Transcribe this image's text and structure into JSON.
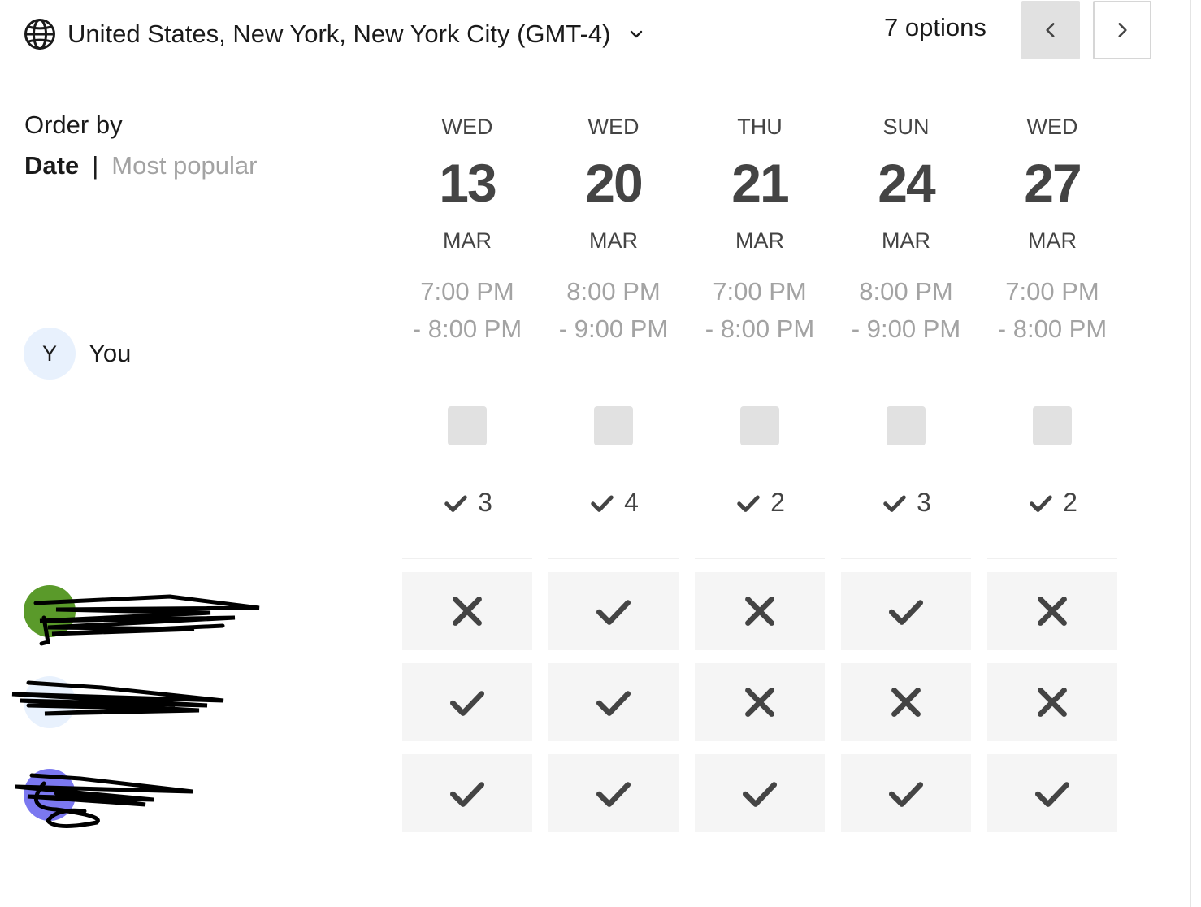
{
  "timezone": {
    "label": "United States, New York, New York City (GMT-4)"
  },
  "pager": {
    "options_label": "7 options"
  },
  "order_by": {
    "title": "Order by",
    "date": "Date",
    "separator": "|",
    "popular": "Most popular"
  },
  "columns": [
    {
      "dow": "WED",
      "day": "13",
      "month": "MAR",
      "time_start": "7:00 PM",
      "time_end": "- 8:00 PM",
      "count": "3"
    },
    {
      "dow": "WED",
      "day": "20",
      "month": "MAR",
      "time_start": "8:00 PM",
      "time_end": "- 9:00 PM",
      "count": "4"
    },
    {
      "dow": "THU",
      "day": "21",
      "month": "MAR",
      "time_start": "7:00 PM",
      "time_end": "- 8:00 PM",
      "count": "2"
    },
    {
      "dow": "SUN",
      "day": "24",
      "month": "MAR",
      "time_start": "8:00 PM",
      "time_end": "- 9:00 PM",
      "count": "3"
    },
    {
      "dow": "WED",
      "day": "27",
      "month": "MAR",
      "time_start": "7:00 PM",
      "time_end": "- 8:00 PM",
      "count": "2"
    }
  ],
  "you": {
    "initial": "Y",
    "name": "You"
  },
  "participants": [
    {
      "avatar_color": "#5a9a2a",
      "votes": [
        "no",
        "yes",
        "no",
        "yes",
        "no"
      ]
    },
    {
      "avatar_color": "#e8f1fd",
      "votes": [
        "yes",
        "yes",
        "no",
        "no",
        "no"
      ]
    },
    {
      "avatar_color": "#7b78f0",
      "votes": [
        "yes",
        "yes",
        "yes",
        "yes",
        "yes"
      ]
    }
  ],
  "colors": {
    "icon": "#444444",
    "muted": "#a3a3a3",
    "cell_bg": "#f5f5f5",
    "checkbox": "#e1e1e1"
  },
  "icons": {
    "timezone": "globe-icon",
    "dropdown": "chevron-down-icon",
    "prev": "chevron-left-icon",
    "next": "chevron-right-icon",
    "yes": "check-icon",
    "no": "x-icon"
  }
}
